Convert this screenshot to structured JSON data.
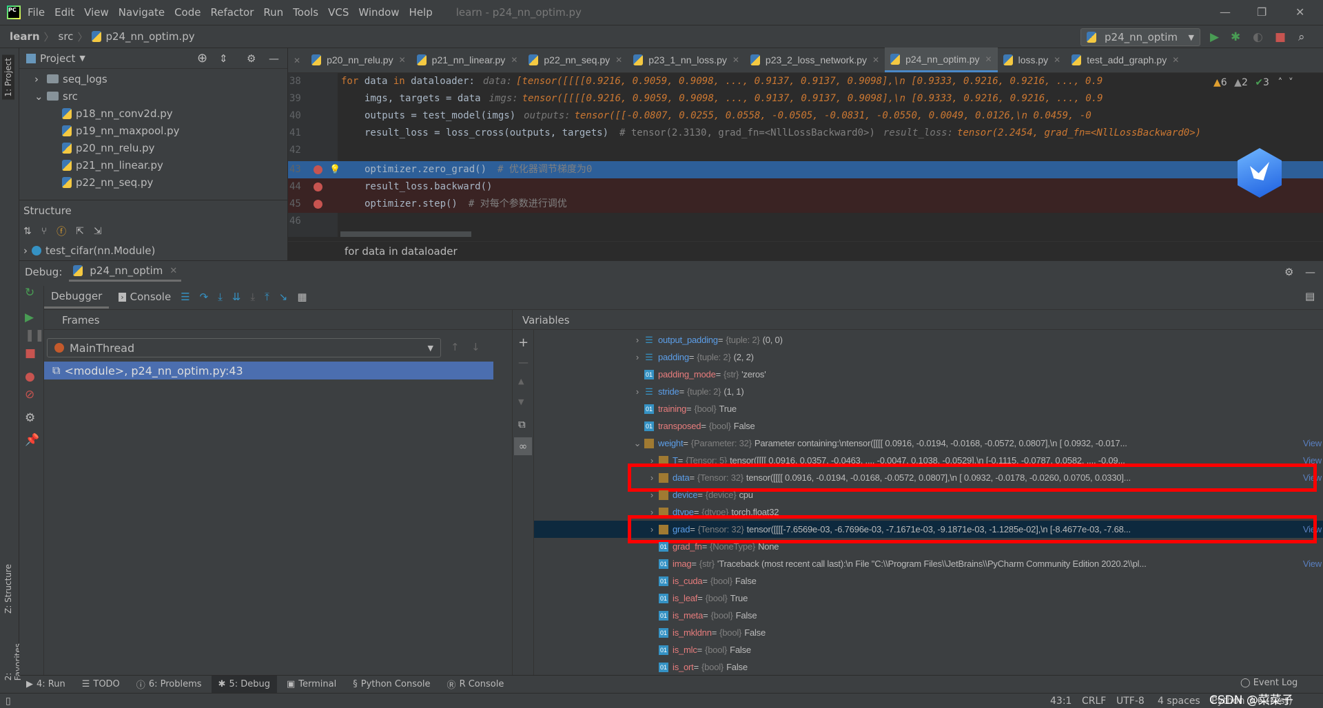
{
  "menubar": {
    "items": [
      "File",
      "Edit",
      "View",
      "Navigate",
      "Code",
      "Refactor",
      "Run",
      "Tools",
      "VCS",
      "Window",
      "Help"
    ],
    "window_title": "learn - p24_nn_optim.py"
  },
  "navbar": {
    "breadcrumb": [
      "learn",
      "src",
      "p24_nn_optim.py"
    ],
    "run_config": "p24_nn_optim"
  },
  "left_strip": {
    "project_tab": "1: Project",
    "structure_tab": "Z: Structure",
    "favorites_tab": "2: Favorites"
  },
  "project": {
    "title": "Project",
    "tree": [
      {
        "label": "seq_logs",
        "type": "folder",
        "depth": 1,
        "expandable": true,
        "expanded": false
      },
      {
        "label": "src",
        "type": "folder",
        "depth": 1,
        "expandable": true,
        "expanded": true
      },
      {
        "label": "p18_nn_conv2d.py",
        "type": "py",
        "depth": 2
      },
      {
        "label": "p19_nn_maxpool.py",
        "type": "py",
        "depth": 2
      },
      {
        "label": "p20_nn_relu.py",
        "type": "py",
        "depth": 2
      },
      {
        "label": "p21_nn_linear.py",
        "type": "py",
        "depth": 2
      },
      {
        "label": "p22_nn_seq.py",
        "type": "py",
        "depth": 2
      }
    ]
  },
  "structure": {
    "title": "Structure",
    "item": "test_cifar(nn.Module)"
  },
  "editor": {
    "tabs": [
      {
        "label": "p20_nn_relu.py",
        "active": false
      },
      {
        "label": "p21_nn_linear.py",
        "active": false
      },
      {
        "label": "p22_nn_seq.py",
        "active": false
      },
      {
        "label": "p23_1_nn_loss.py",
        "active": false
      },
      {
        "label": "p23_2_loss_network.py",
        "active": false
      },
      {
        "label": "p24_nn_optim.py",
        "active": true
      },
      {
        "label": "loss.py",
        "active": false
      },
      {
        "label": "test_add_graph.py",
        "active": false
      }
    ],
    "inspections": {
      "warnings": "6",
      "weak_warnings": "2",
      "ok": "3"
    },
    "lines": [
      {
        "n": "38",
        "indent": 0,
        "code": "for data in dataloader:",
        "comment": "",
        "hint_label": "data:",
        "hint_value": "[tensor([[[[0.9216, 0.9059, 0.9098,  ..., 0.9137, 0.9137, 0.9098],\\n          [0.9333, 0.9216, 0.9216,  ..., 0.9",
        "breakpoint": false
      },
      {
        "n": "39",
        "indent": 1,
        "code": "imgs, targets = data",
        "comment": "",
        "hint_label": "imgs:",
        "hint_value": "tensor([[[[0.9216, 0.9059, 0.9098,  ..., 0.9137, 0.9137, 0.9098],\\n          [0.9333, 0.9216, 0.9216,  ..., 0.9",
        "breakpoint": false
      },
      {
        "n": "40",
        "indent": 1,
        "code": "outputs = test_model(imgs)",
        "comment": "",
        "hint_label": "outputs:",
        "hint_value": "tensor([[-0.0807,  0.0255,  0.0558, -0.0505, -0.0831, -0.0550,  0.0049,  0.0126,\\n          0.0459, -0",
        "breakpoint": false
      },
      {
        "n": "41",
        "indent": 1,
        "code": "result_loss = loss_cross(outputs, targets)",
        "comment": "# tensor(2.3130, grad_fn=<NllLossBackward0>)",
        "hint_label": "result_loss:",
        "hint_value": "tensor(2.2454, grad_fn=<NllLossBackward0>)",
        "breakpoint": false
      },
      {
        "n": "42",
        "indent": 0,
        "code": "",
        "comment": "",
        "hint_label": "",
        "hint_value": "",
        "breakpoint": false
      },
      {
        "n": "43",
        "indent": 1,
        "code": "optimizer.zero_grad()",
        "comment": "# 优化器调节梯度为0",
        "hint_label": "",
        "hint_value": "",
        "breakpoint": true,
        "current": true
      },
      {
        "n": "44",
        "indent": 1,
        "code": "result_loss.backward()",
        "comment": "",
        "hint_label": "",
        "hint_value": "",
        "breakpoint": true
      },
      {
        "n": "45",
        "indent": 1,
        "code": "optimizer.step()",
        "comment": "# 对每个参数进行调优",
        "hint_label": "",
        "hint_value": "",
        "breakpoint": true
      },
      {
        "n": "46",
        "indent": 0,
        "code": "",
        "comment": "",
        "hint_label": "",
        "hint_value": "",
        "breakpoint": false
      }
    ],
    "breadcrumb": "for data in dataloader"
  },
  "debug": {
    "label": "Debug:",
    "session_tab": "p24_nn_optim",
    "tabs": [
      "Debugger",
      "Console"
    ],
    "frames_title": "Frames",
    "thread": "MainThread",
    "frame": "<module>, p24_nn_optim.py:43",
    "variables_title": "Variables",
    "variables": [
      {
        "name": "output_padding",
        "type": "{tuple: 2}",
        "value": "(0, 0)",
        "depth": 0,
        "icon": "list",
        "expandable": true
      },
      {
        "name": "padding",
        "type": "{tuple: 2}",
        "value": "(2, 2)",
        "depth": 0,
        "icon": "list",
        "expandable": true
      },
      {
        "name": "padding_mode",
        "type": "{str}",
        "value": "'zeros'",
        "depth": 0,
        "icon": "prim"
      },
      {
        "name": "stride",
        "type": "{tuple: 2}",
        "value": "(1, 1)",
        "depth": 0,
        "icon": "list",
        "expandable": true
      },
      {
        "name": "training",
        "type": "{bool}",
        "value": "True",
        "depth": 0,
        "icon": "prim"
      },
      {
        "name": "transposed",
        "type": "{bool}",
        "value": "False",
        "depth": 0,
        "icon": "prim"
      },
      {
        "name": "weight",
        "type": "{Parameter: 32}",
        "value": "Parameter containing:\\ntensor([[[[ 0.0916, -0.0194, -0.0168, -0.0572,  0.0807],\\n          [ 0.0932, -0.017...",
        "depth": 0,
        "icon": "obj",
        "expandable": true,
        "expanded": true,
        "view": "View"
      },
      {
        "name": "T",
        "type": "{Tensor: 5}",
        "value": "tensor([[[[ 0.0916,  0.0357, -0.0463,  ..., -0.0047,  0.1038, -0.0529],\\n          [-0.1115, -0.0787,  0.0582,  ..., -0.09...",
        "depth": 1,
        "icon": "obj",
        "expandable": true,
        "view": "View"
      },
      {
        "name": "data",
        "type": "{Tensor: 32}",
        "value": "tensor([[[[ 0.0916, -0.0194, -0.0168, -0.0572,  0.0807],\\n          [ 0.0932, -0.0178, -0.0260,  0.0705,  0.0330]...",
        "depth": 1,
        "icon": "obj",
        "expandable": true,
        "view": "View",
        "highlighted": true
      },
      {
        "name": "device",
        "type": "{device}",
        "value": "cpu",
        "depth": 1,
        "icon": "obj",
        "expandable": true
      },
      {
        "name": "dtype",
        "type": "{dtype}",
        "value": "torch.float32",
        "depth": 1,
        "icon": "obj",
        "expandable": true
      },
      {
        "name": "grad",
        "type": "{Tensor: 32}",
        "value": "tensor([[[[-7.6569e-03, -6.7696e-03, -7.1671e-03, -9.1871e-03, -1.1285e-02],\\n          [-8.4677e-03, -7.68...",
        "depth": 1,
        "icon": "obj",
        "expandable": true,
        "view": "View",
        "selected": true,
        "highlighted": true
      },
      {
        "name": "grad_fn",
        "type": "{NoneType}",
        "value": "None",
        "depth": 1,
        "icon": "prim"
      },
      {
        "name": "imag",
        "type": "{str}",
        "value": "'Traceback (most recent call last):\\n  File \"C:\\\\Program Files\\\\JetBrains\\\\PyCharm Community Edition 2020.2\\\\pl...",
        "depth": 1,
        "icon": "prim",
        "view": "View"
      },
      {
        "name": "is_cuda",
        "type": "{bool}",
        "value": "False",
        "depth": 1,
        "icon": "prim"
      },
      {
        "name": "is_leaf",
        "type": "{bool}",
        "value": "True",
        "depth": 1,
        "icon": "prim"
      },
      {
        "name": "is_meta",
        "type": "{bool}",
        "value": "False",
        "depth": 1,
        "icon": "prim"
      },
      {
        "name": "is_mkldnn",
        "type": "{bool}",
        "value": "False",
        "depth": 1,
        "icon": "prim"
      },
      {
        "name": "is_mlc",
        "type": "{bool}",
        "value": "False",
        "depth": 1,
        "icon": "prim"
      },
      {
        "name": "is_ort",
        "type": "{bool}",
        "value": "False",
        "depth": 1,
        "icon": "prim"
      }
    ]
  },
  "tool_windows": [
    {
      "label": "4: Run",
      "icon": "run-icon"
    },
    {
      "label": "TODO",
      "icon": "todo-icon"
    },
    {
      "label": "6: Problems",
      "icon": "problems-icon"
    },
    {
      "label": "5: Debug",
      "icon": "debug-icon",
      "active": true
    },
    {
      "label": "Terminal",
      "icon": "terminal-icon"
    },
    {
      "label": "Python Console",
      "icon": "python-console-icon"
    },
    {
      "label": "R Console",
      "icon": "r-console-icon"
    }
  ],
  "event_log": "Event Log",
  "statusbar": {
    "position": "43:1",
    "line_sep": "CRLF",
    "encoding": "UTF-8",
    "indent": "4 spaces",
    "interpreter": "Python 3.6 (test)"
  },
  "watermark": "CSDN @菜菜子",
  "colors": {
    "accent": "#4b6eaf",
    "breakpoint": "#c75450",
    "highlight_box": "#ff0000",
    "current_line": "#2d5f99",
    "breakpoint_line": "#3a2323"
  }
}
